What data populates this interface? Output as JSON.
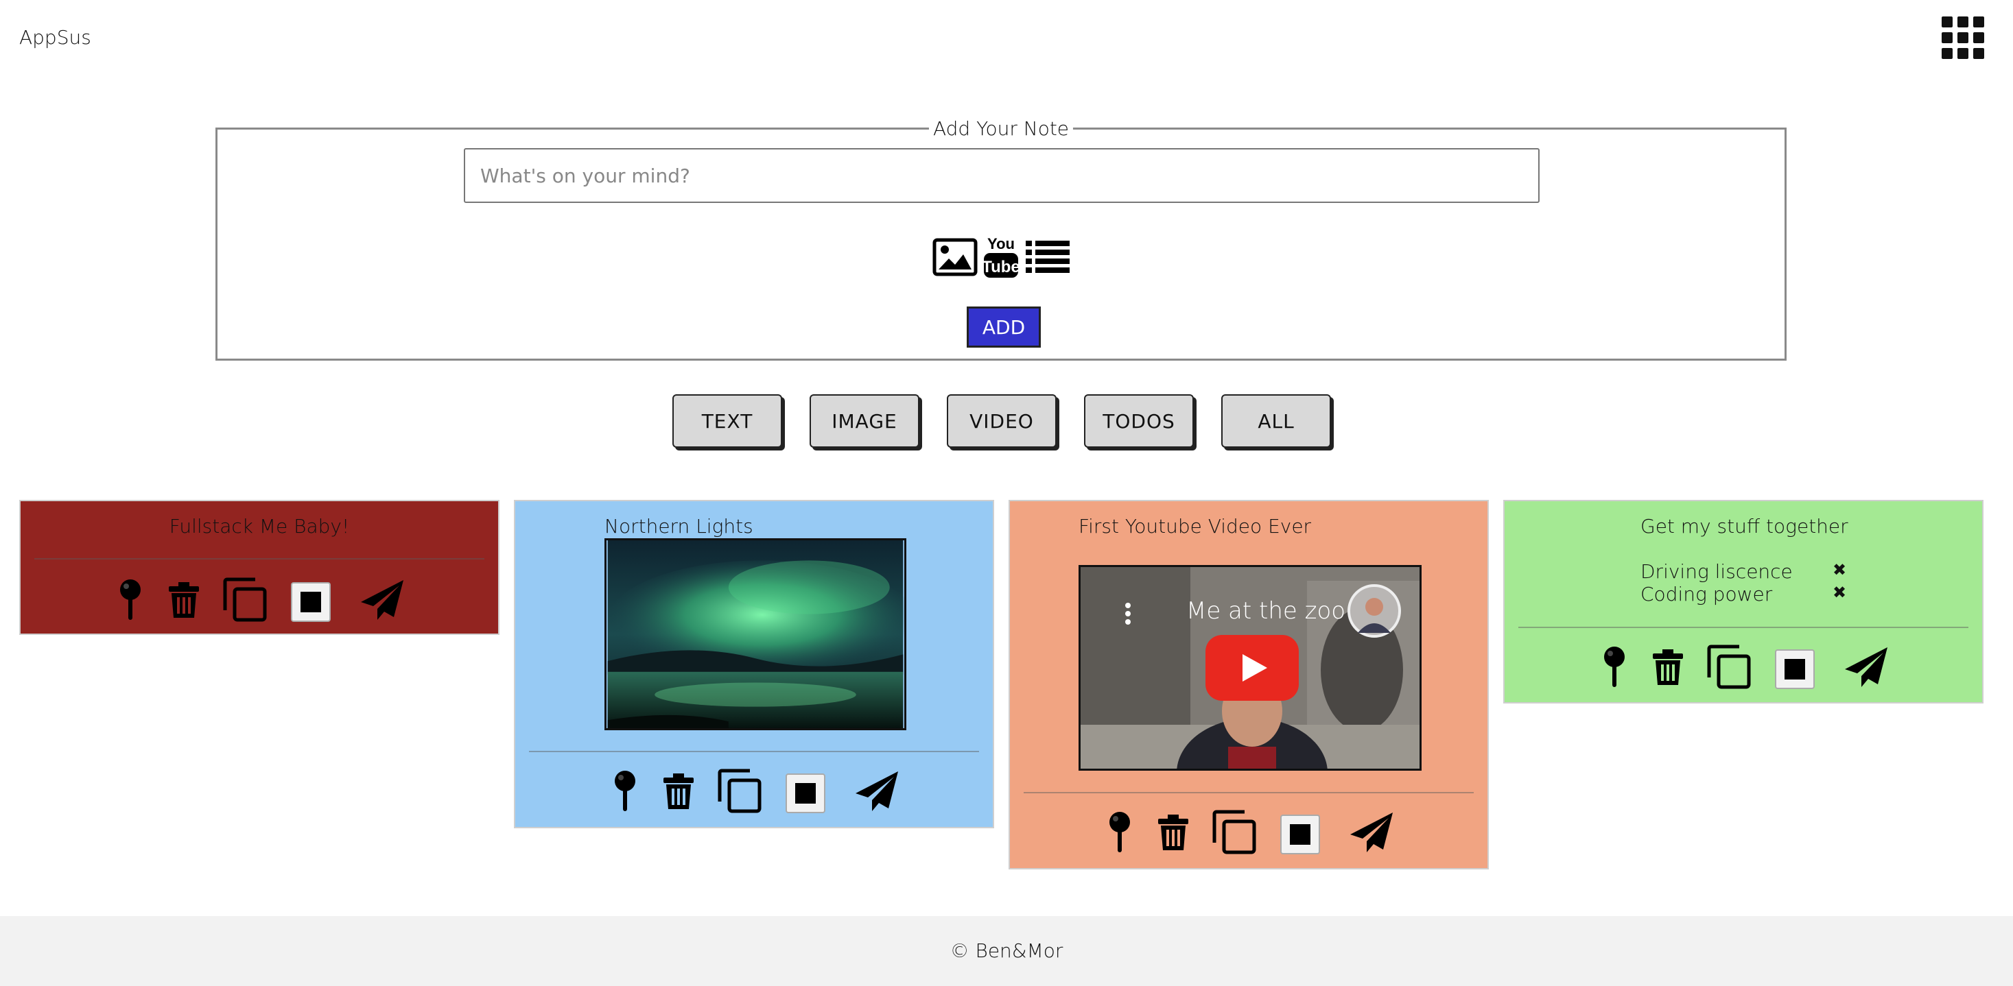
{
  "app": {
    "logo": "AppSus",
    "apps_icon": "grid-icon"
  },
  "form": {
    "legend": "Add Your Note",
    "placeholder": "What's on your mind?",
    "value": "",
    "type_icons": [
      "image-icon",
      "youtube-icon",
      "list-icon"
    ],
    "add_label": "ADD"
  },
  "filters": [
    "TEXT",
    "IMAGE",
    "VIDEO",
    "TODOS",
    "ALL"
  ],
  "notes": [
    {
      "type": "text",
      "title": "Fullstack Me Baby!",
      "bg": "#922420"
    },
    {
      "type": "image",
      "title": "Northern Lights",
      "bg": "#97caf4"
    },
    {
      "type": "video",
      "title": "First Youtube Video Ever",
      "video_title": "Me at the zoo",
      "bg": "#f1a482"
    },
    {
      "type": "todos",
      "title": "Get my stuff together",
      "todos": [
        "Driving liscence",
        "Coding power"
      ],
      "bg": "#a4e993"
    }
  ],
  "note_actions": [
    "pin-icon",
    "trash-icon",
    "copy-icon",
    "color-swatch",
    "send-icon"
  ],
  "footer": {
    "text": "© Ben&Mor"
  }
}
